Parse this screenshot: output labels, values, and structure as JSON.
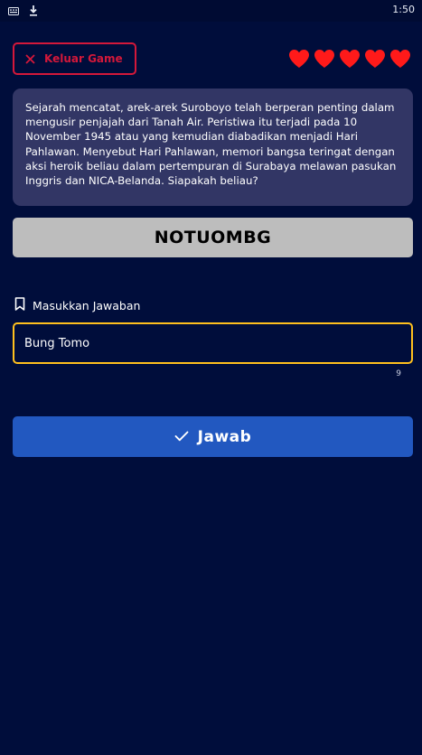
{
  "status_bar": {
    "time": "1:50",
    "icons": [
      "notification-icon",
      "download-icon"
    ]
  },
  "header": {
    "exit_label": "Keluar Game",
    "exit_icon": "close-icon",
    "lives": 5,
    "heart_color": "#ff1a1a"
  },
  "question": {
    "text": "Sejarah mencatat, arek-arek Suroboyo telah berperan penting dalam mengusir penjajah dari Tanah Air. Peristiwa itu terjadi pada 10 November 1945 atau yang kemudian diabadikan menjadi Hari Pahlawan. Menyebut Hari Pahlawan, memori bangsa teringat dengan aksi heroik beliau dalam pertempuran di Surabaya melawan pasukan Inggris dan NICA-Belanda. Siapakah beliau?"
  },
  "scramble": {
    "letters": "NOTUOMBG"
  },
  "answer": {
    "label": "Masukkan Jawaban",
    "label_icon": "bookmark-icon",
    "value": "Bung Tomo",
    "char_count": "9"
  },
  "submit": {
    "label": "Jawab",
    "icon": "check-icon"
  },
  "colors": {
    "background": "#000d3b",
    "card": "#323665",
    "accent_red": "#d4183a",
    "input_border": "#ffc01e",
    "button_blue": "#2258c0",
    "scramble_bg": "#bdbdbd"
  }
}
